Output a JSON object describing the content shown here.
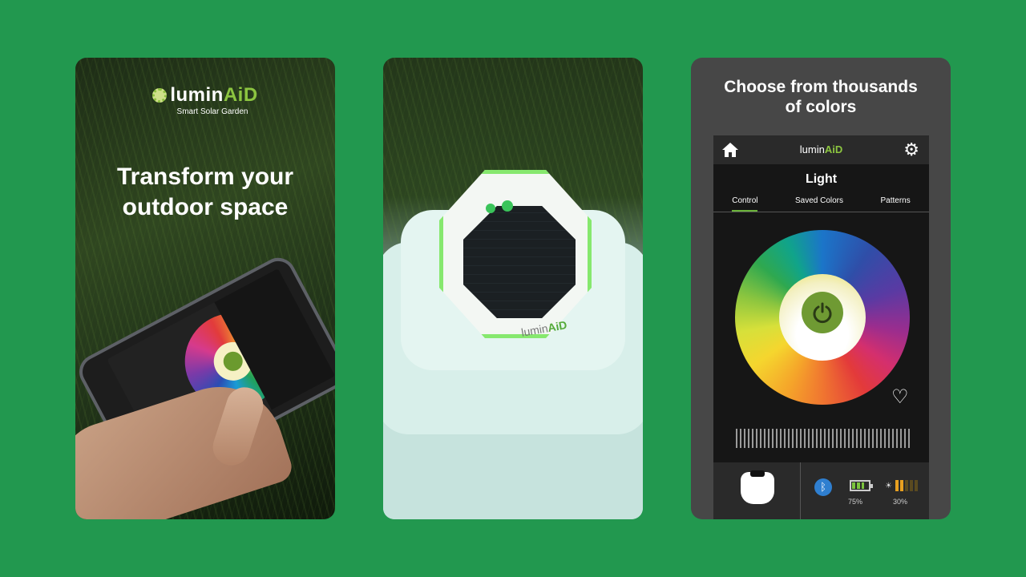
{
  "card1": {
    "brand": "luminAID",
    "brand_parts": [
      "lumin",
      "AiD"
    ],
    "brand_sub": "Smart Solar Garden",
    "headline_lines": [
      "Transform your",
      "outdoor space"
    ]
  },
  "card2": {
    "lamp_brand_parts": [
      "lumin",
      "AiD"
    ]
  },
  "card3": {
    "headline_lines": [
      "Choose from thousands",
      "of colors"
    ],
    "app": {
      "logo_parts": [
        "lumin",
        "AiD"
      ],
      "title": "Light",
      "tabs": [
        "Control",
        "Saved Colors",
        "Patterns"
      ],
      "active_tab": "Control",
      "icons": [
        "home-icon",
        "gear-icon",
        "power-icon",
        "heart-icon",
        "bluetooth-icon",
        "battery-icon",
        "light-level-icon"
      ],
      "battery_level": 0.75,
      "battery_label": "75%",
      "light_level": 0.3,
      "light_label": "30%"
    }
  },
  "colors": {
    "background": "#22984f",
    "accent_green": "#8cc540",
    "power_button": "#6f9a33",
    "bluetooth": "#2f7fd0"
  }
}
